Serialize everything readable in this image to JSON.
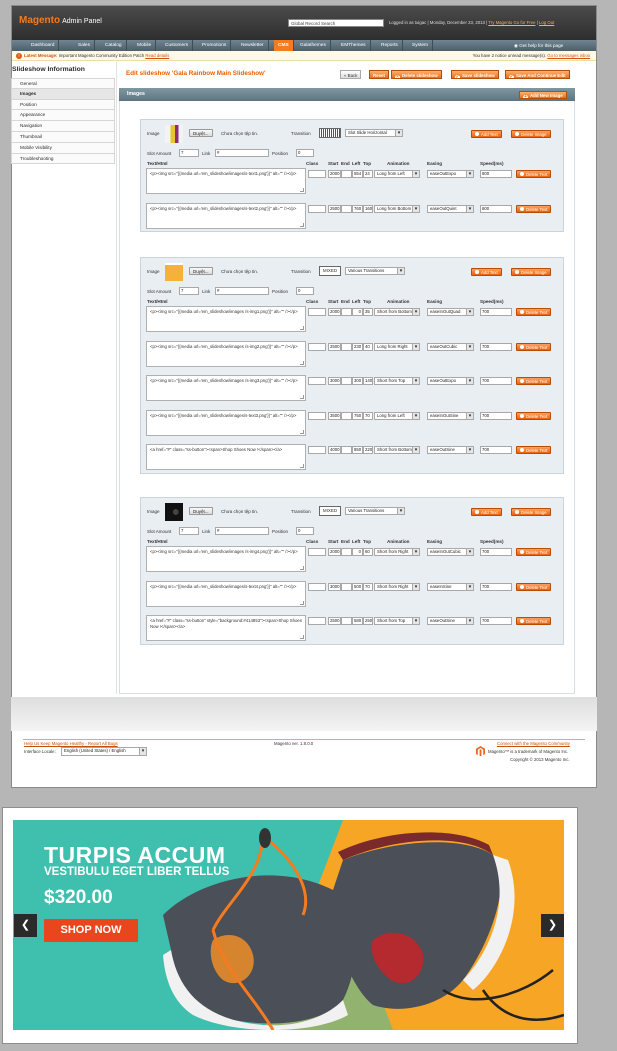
{
  "header": {
    "app_title_brand": "Magento",
    "app_title_rest": "Admin Panel",
    "global_search": "Global Record Search",
    "logged_in": "Logged in as tuigac",
    "date": "Monday, December 23, 2013",
    "try_link": "Try Magento Go for Free",
    "logout": "Log Out",
    "help": "Get help for this page"
  },
  "nav": [
    "Dashboard",
    "Sales",
    "Catalog",
    "Mobile",
    "Customers",
    "Promotions",
    "Newsletter",
    "CMS",
    "Galathemes",
    "EMThemes",
    "Reports",
    "System"
  ],
  "notice": {
    "label": "Latest Message:",
    "text": "Important Magento Community Edition Patch",
    "link": "Read details",
    "right_text": "You have 2 notice unread message(s).",
    "right_link": "Go to messages inbox"
  },
  "sidebar": {
    "title": "Slideshow Information",
    "items": [
      "General",
      "Images",
      "Position",
      "Appearance",
      "Navigation",
      "Thumbnail",
      "Mobile Visibility",
      "Troubleshooting"
    ]
  },
  "page": {
    "title": "Edit slideshow 'Gala Rainbow Main Slideshow'",
    "btn_back": "Back",
    "btn_reset": "Reset",
    "btn_delete": "Delete slideshow",
    "btn_save": "Save slideshow",
    "btn_save_continue": "Save And Continue Edit",
    "section_title": "Images",
    "add_image": "Add New Image"
  },
  "form_labels": {
    "image": "Image",
    "browse": "Duyệt...",
    "no_file": "Chưa chọn tệp tin.",
    "transition": "Transition",
    "slot_amount": "Slot Amount",
    "link": "Link",
    "position": "Position",
    "text_html": "Text/Html",
    "class": "Class",
    "start": "Start",
    "end": "End",
    "left": "Left",
    "top": "Top",
    "animation": "Animation",
    "easing": "Easing",
    "speed": "Speed(ms)",
    "add_text": "Add Text",
    "delete_image": "Delete Image",
    "delete_text": "Delete Text"
  },
  "slides": [
    {
      "transition_preview": "",
      "transition": "Slot Slide Horizontal",
      "slot_amount": "7",
      "link": "#",
      "position": "0",
      "texts": [
        {
          "html": "<p><img src=\"{{media url='em_slideshow/images/s-text1.png'}}\" alt=\"\" /></p>",
          "start": "2000",
          "end": "",
          "left": "554",
          "top": "24",
          "animation": "Long from Left",
          "easing": "easeOutExpo",
          "speed": "800"
        },
        {
          "html": "<p><img src=\"{{media url='em_slideshow/images/s-text2.png'}}\" alt=\"\" /></p>",
          "start": "2500",
          "end": "",
          "left": "760",
          "top": "160",
          "animation": "Long from Bottom",
          "easing": "easeOutQuint",
          "speed": "800"
        }
      ]
    },
    {
      "transition_preview": "MIXED",
      "transition": "Various Transitions",
      "slot_amount": "7",
      "link": "#",
      "position": "0",
      "texts": [
        {
          "html": "<p><img src=\"{{media url='em_slideshow/images /s-img1.png'}}\" alt=\"\" /></p>",
          "start": "2000",
          "end": "",
          "left": "0",
          "top": "35",
          "animation": "Short from Bottom",
          "easing": "easeInOutQuad",
          "speed": "700"
        },
        {
          "html": "<p><img src=\"{{media url='em_slideshow/images /s-img2.png'}}\" alt=\"\" /></p>",
          "start": "2500",
          "end": "",
          "left": "230",
          "top": "40",
          "animation": "Long from Right",
          "easing": "easeOutCubic",
          "speed": "700"
        },
        {
          "html": "<p><img src=\"{{media url='em_slideshow/images /s-img3.png'}}\" alt=\"\" /></p>",
          "start": "3000",
          "end": "",
          "left": "300",
          "top": "140",
          "animation": "Short from Top",
          "easing": "easeOutExpo",
          "speed": "700"
        },
        {
          "html": "<p><img src=\"{{media url='em_slideshow/images/s-text3.png'}}\" alt=\"\" /></p>",
          "start": "3500",
          "end": "",
          "left": "750",
          "top": "70",
          "animation": "Long from Left",
          "easing": "easeInOutSine",
          "speed": "700"
        },
        {
          "html": "<a href=\"#\" class=\"ss-button\"><span>Shop Shoes Now !</span></a>",
          "start": "4000",
          "end": "",
          "left": "850",
          "top": "220",
          "animation": "Short from Bottom",
          "easing": "easeOutSine",
          "speed": "700"
        }
      ]
    },
    {
      "transition_preview": "MIXED",
      "transition": "Various Transitions",
      "slot_amount": "7",
      "link": "#",
      "position": "0",
      "texts": [
        {
          "html": "<p><img src=\"{{media url='em_slideshow/images /s-img4.png'}}\" alt=\"\" /></p>",
          "start": "2000",
          "end": "",
          "left": "0",
          "top": "60",
          "animation": "Short from Right",
          "easing": "easeInOutCubic",
          "speed": "700"
        },
        {
          "html": "<p><img src=\"{{media url='em_slideshow/images/s-text4.png'}}\" alt=\"\" /></p>",
          "start": "3000",
          "end": "",
          "left": "500",
          "top": "70",
          "animation": "Short from Right",
          "easing": "easeInSine",
          "speed": "700"
        },
        {
          "html": "<a href=\"#\" class=\"ss-button\" style=\"background:#414853\"><span>Shop Shoes Now !</span></a>",
          "start": "2500",
          "end": "",
          "left": "580",
          "top": "250",
          "animation": "Short from Top",
          "easing": "easeOutSine",
          "speed": "700"
        }
      ]
    }
  ],
  "footer": {
    "help_link": "Help Us Keep Magento Healthy - Report All Bugs",
    "locale_label": "Interface Locale:",
    "locale_value": "English (United States) / English",
    "version": "Magento ver. 1.8.0.0",
    "community_link": "Connect with the Magento Community",
    "trademark": "Magento™ is a trademark of Magento Inc.",
    "copyright": "Copyright © 2013 Magento Inc."
  },
  "banner": {
    "title": "TURPIS ACCUM",
    "subtitle": "VESTIBULU EGET LIBER TELLUS",
    "price": "$320.00",
    "cta": "SHOP NOW",
    "prev_icon": "chevron-left-icon",
    "next_icon": "chevron-right-icon"
  },
  "colors": {
    "accent": "#f47b20",
    "header_bg": "#3c3c3c",
    "nav_bg": "#5b6f7a",
    "banner_teal": "#3fbfae",
    "banner_orange": "#f7a525",
    "cta_red": "#e8471e"
  }
}
